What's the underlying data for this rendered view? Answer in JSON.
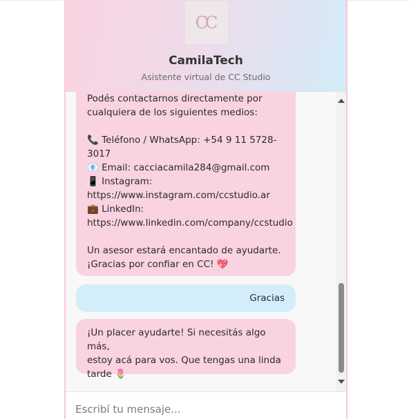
{
  "header": {
    "logo_text": "CC",
    "title": "CamilaTech",
    "subtitle": "Asistente virtual de CC Studio"
  },
  "messages": [
    {
      "sender": "bot",
      "text": "Podés contactarnos directamente por\ncualquiera de los siguientes medios:\n\n📞 Teléfono / WhatsApp: +54 9 11 5728-\n3017\n📧 Email: cacciacamila284@gmail.com\n📱 Instagram:\nhttps://www.instagram.com/ccstudio.ar\n💼 LinkedIn:\nhttps://www.linkedin.com/company/ccstudio\n\nUn asesor estará encantado de ayudarte.\n¡Gracias por confiar en CC! 💖"
    },
    {
      "sender": "user",
      "text": "Gracias"
    },
    {
      "sender": "bot",
      "text": "¡Un placer ayudarte! Si necesitás algo más,\nestoy acá para vos. Que tengas una linda\ntarde 🌷"
    }
  ],
  "input": {
    "placeholder": "Escribí tu mensaje..."
  },
  "colors": {
    "bot_bubble": "#fad3e0",
    "user_bubble": "#d3eefa",
    "widget_border": "#f7c9d8"
  }
}
